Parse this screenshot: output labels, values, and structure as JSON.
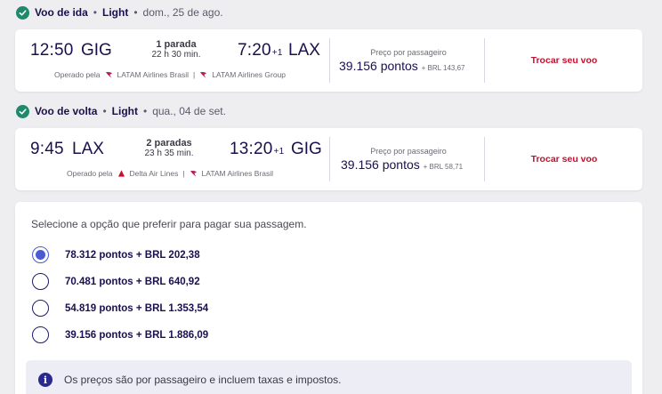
{
  "outbound": {
    "header": {
      "title": "Voo de ida",
      "fare": "Light",
      "date": "dom., 25 de ago."
    },
    "depart_time": "12:50",
    "depart_airport": "GIG",
    "stops_label": "1 parada",
    "duration": "22 h 30 min.",
    "arrive_time": "7:20",
    "arrive_plus": "+1",
    "arrive_airport": "LAX",
    "operated_prefix": "Operado pela",
    "operators": [
      "LATAM Airlines Brasil",
      "LATAM Airlines Group"
    ],
    "price_label": "Preço por passageiro",
    "price_points": "39.156 pontos",
    "price_brl": "+ BRL 143,67",
    "change_label": "Trocar seu voo"
  },
  "return": {
    "header": {
      "title": "Voo de volta",
      "fare": "Light",
      "date": "qua., 04 de set."
    },
    "depart_time": "9:45",
    "depart_airport": "LAX",
    "stops_label": "2 paradas",
    "duration": "23 h 35 min.",
    "arrive_time": "13:20",
    "arrive_plus": "+1",
    "arrive_airport": "GIG",
    "operated_prefix": "Operado pela",
    "operators": [
      "Delta Air Lines",
      "LATAM Airlines Brasil"
    ],
    "price_label": "Preço por passageiro",
    "price_points": "39.156 pontos",
    "price_brl": "+ BRL 58,71",
    "change_label": "Trocar seu voo"
  },
  "payment": {
    "title": "Selecione a opção que preferir para pagar sua passagem.",
    "options": [
      {
        "label": "78.312 pontos + BRL 202,38",
        "selected": true
      },
      {
        "label": "70.481 pontos + BRL 640,92",
        "selected": false
      },
      {
        "label": "54.819 pontos + BRL 1.353,54",
        "selected": false
      },
      {
        "label": "39.156 pontos + BRL 1.886,09",
        "selected": false
      }
    ],
    "info_text": "Os preços são por passageiro e incluem taxas e impostos."
  },
  "colors": {
    "accent": "#4a5bd4",
    "brand_dark": "#1b0f4d",
    "check_green": "#1f8a6a",
    "link_red": "#c8102e",
    "latam_logo": "#b01e5a",
    "delta_logo": "#c8102e"
  }
}
